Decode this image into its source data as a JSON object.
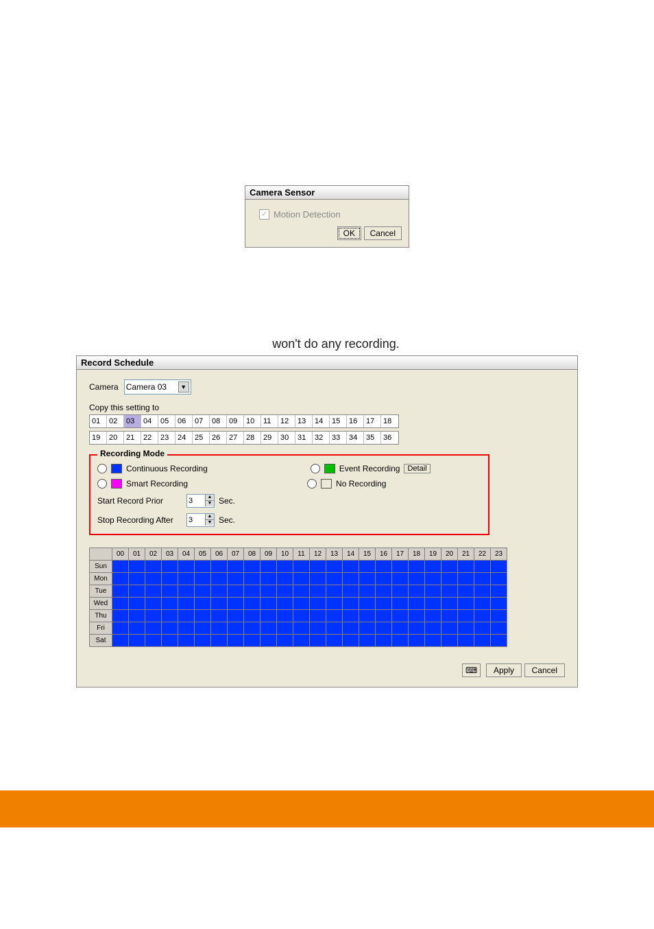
{
  "sensor": {
    "title": "Camera Sensor",
    "motion_label": "Motion Detection",
    "ok": "OK",
    "cancel": "Cancel"
  },
  "caption": "won't do any recording.",
  "schedule": {
    "title": "Record Schedule",
    "camera_label": "Camera",
    "camera_selected": "Camera 03",
    "copy_label": "Copy this setting to",
    "row1": [
      "01",
      "02",
      "03",
      "04",
      "05",
      "06",
      "07",
      "08",
      "09",
      "10",
      "11",
      "12",
      "13",
      "14",
      "15",
      "16",
      "17",
      "18"
    ],
    "row1_selected_index": 2,
    "row2": [
      "19",
      "20",
      "21",
      "22",
      "23",
      "24",
      "25",
      "26",
      "27",
      "28",
      "29",
      "30",
      "31",
      "32",
      "33",
      "34",
      "35",
      "36"
    ],
    "mode": {
      "legend": "Recording Mode",
      "continuous": "Continuous Recording",
      "event": "Event Recording",
      "detail": "Detail",
      "smart": "Smart Recording",
      "none": "No Recording",
      "start_prior_label": "Start Record Prior",
      "start_prior_value": "3",
      "stop_after_label": "Stop Recording After",
      "stop_after_value": "3",
      "sec": "Sec."
    },
    "hours": [
      "00",
      "01",
      "02",
      "03",
      "04",
      "05",
      "06",
      "07",
      "08",
      "09",
      "10",
      "11",
      "12",
      "13",
      "14",
      "15",
      "16",
      "17",
      "18",
      "19",
      "20",
      "21",
      "22",
      "23"
    ],
    "days": [
      "Sun",
      "Mon",
      "Tue",
      "Wed",
      "Thu",
      "Fri",
      "Sat"
    ],
    "apply": "Apply",
    "cancel": "Cancel"
  }
}
